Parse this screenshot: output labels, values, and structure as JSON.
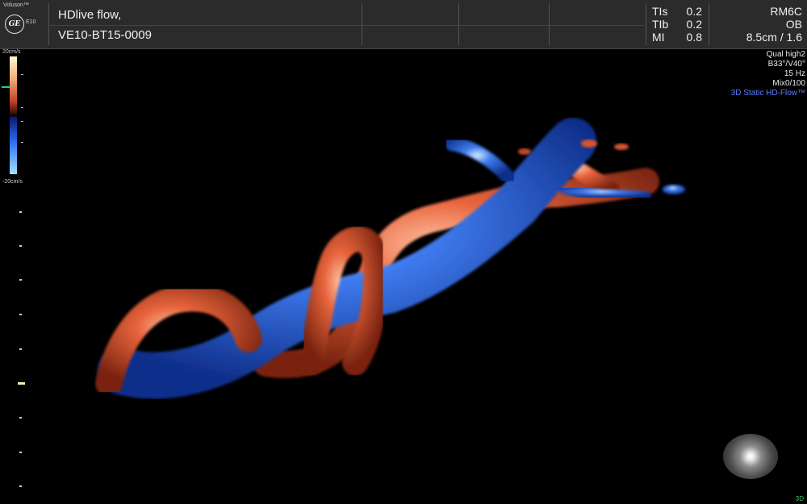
{
  "header": {
    "brand": "Voluson™",
    "logo": "GE",
    "model": "E10",
    "title_line1": "HDlive flow,",
    "title_line2": "VE10-BT15-0009",
    "params": [
      {
        "label": "TIs",
        "value": "0.2"
      },
      {
        "label": "TIb",
        "value": "0.2"
      },
      {
        "label": "MI",
        "value": "0.8"
      }
    ],
    "probe": "RM6C",
    "preset": "OB",
    "depth": "8.5cm / 1.6"
  },
  "side_info": {
    "quality": "Qual high2",
    "angle": "B33°/V40°",
    "rate": "15 Hz",
    "mix": "Mix0/100",
    "mode": "3D Static HD-Flow™"
  },
  "color_scale": {
    "top_label": "20cm/s",
    "bottom_label": "-20cm/s"
  },
  "corner_tag": "3D",
  "colors": {
    "flow_toward": "#e8643c",
    "flow_away": "#3f7bee",
    "mode_text": "#5a7dff"
  }
}
